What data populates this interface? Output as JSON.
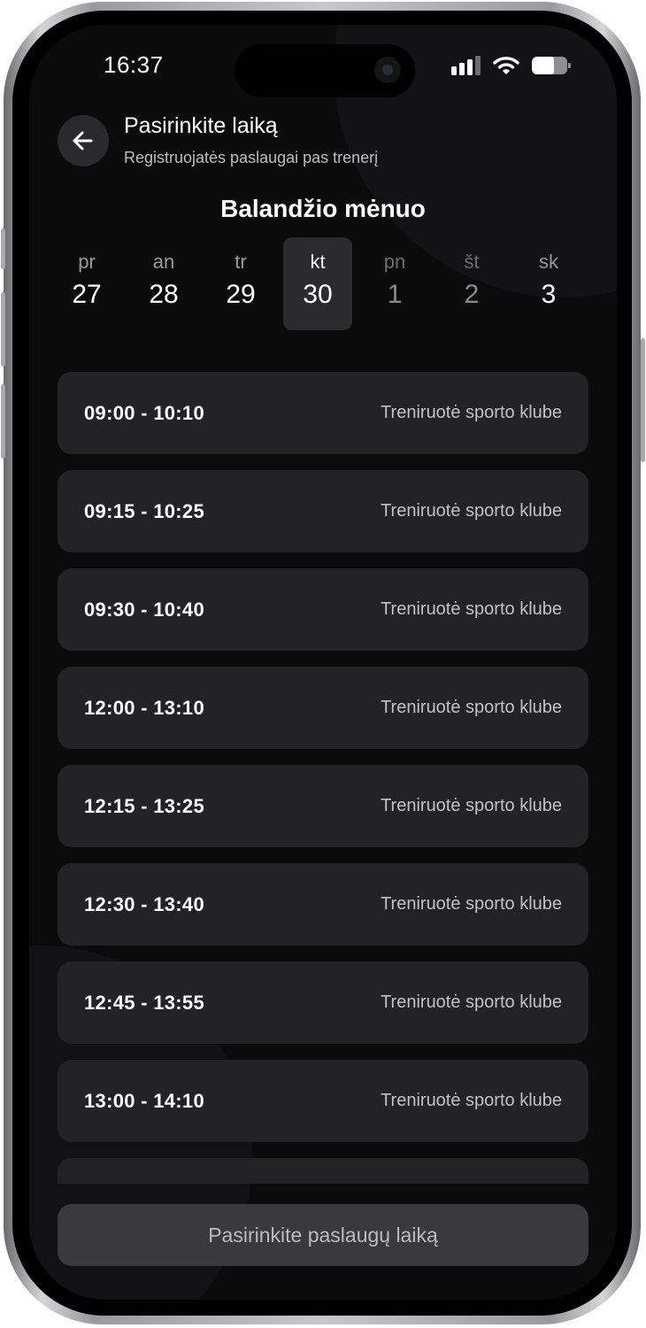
{
  "status_bar": {
    "time": "16:37",
    "icons": [
      "signal-icon",
      "wifi-icon",
      "battery-icon"
    ]
  },
  "header": {
    "back_icon": "arrow-left-icon",
    "title": "Pasirinkite laiką",
    "subtitle": "Registruojatės paslaugai pas trenerį"
  },
  "calendar": {
    "month_title": "Balandžio mėnuo",
    "days": [
      {
        "label": "pr",
        "number": "27"
      },
      {
        "label": "an",
        "number": "28"
      },
      {
        "label": "tr",
        "number": "29"
      },
      {
        "label": "kt",
        "number": "30",
        "selected": true
      },
      {
        "label": "pn",
        "number": "1",
        "muted": true
      },
      {
        "label": "št",
        "number": "2",
        "muted": true
      },
      {
        "label": "sk",
        "number": "3"
      }
    ]
  },
  "slots": [
    {
      "time": "09:00 - 10:10",
      "service": "Treniruotė sporto klube"
    },
    {
      "time": "09:15 - 10:25",
      "service": "Treniruotė sporto klube"
    },
    {
      "time": "09:30 - 10:40",
      "service": "Treniruotė sporto klube"
    },
    {
      "time": "12:00 - 13:10",
      "service": "Treniruotė sporto klube"
    },
    {
      "time": "12:15 - 13:25",
      "service": "Treniruotė sporto klube"
    },
    {
      "time": "12:30 - 13:40",
      "service": "Treniruotė sporto klube"
    },
    {
      "time": "12:45 - 13:55",
      "service": "Treniruotė sporto klube"
    },
    {
      "time": "13:00 - 14:10",
      "service": "Treniruotė sporto klube"
    },
    {
      "time": "",
      "service": ""
    }
  ],
  "footer": {
    "cta_label": "Pasirinkite paslaugų laiką"
  },
  "colors": {
    "background": "#0b0b0c",
    "card": "#232325",
    "selected_day": "#2b2b2d",
    "button": "#3a3a3c"
  }
}
